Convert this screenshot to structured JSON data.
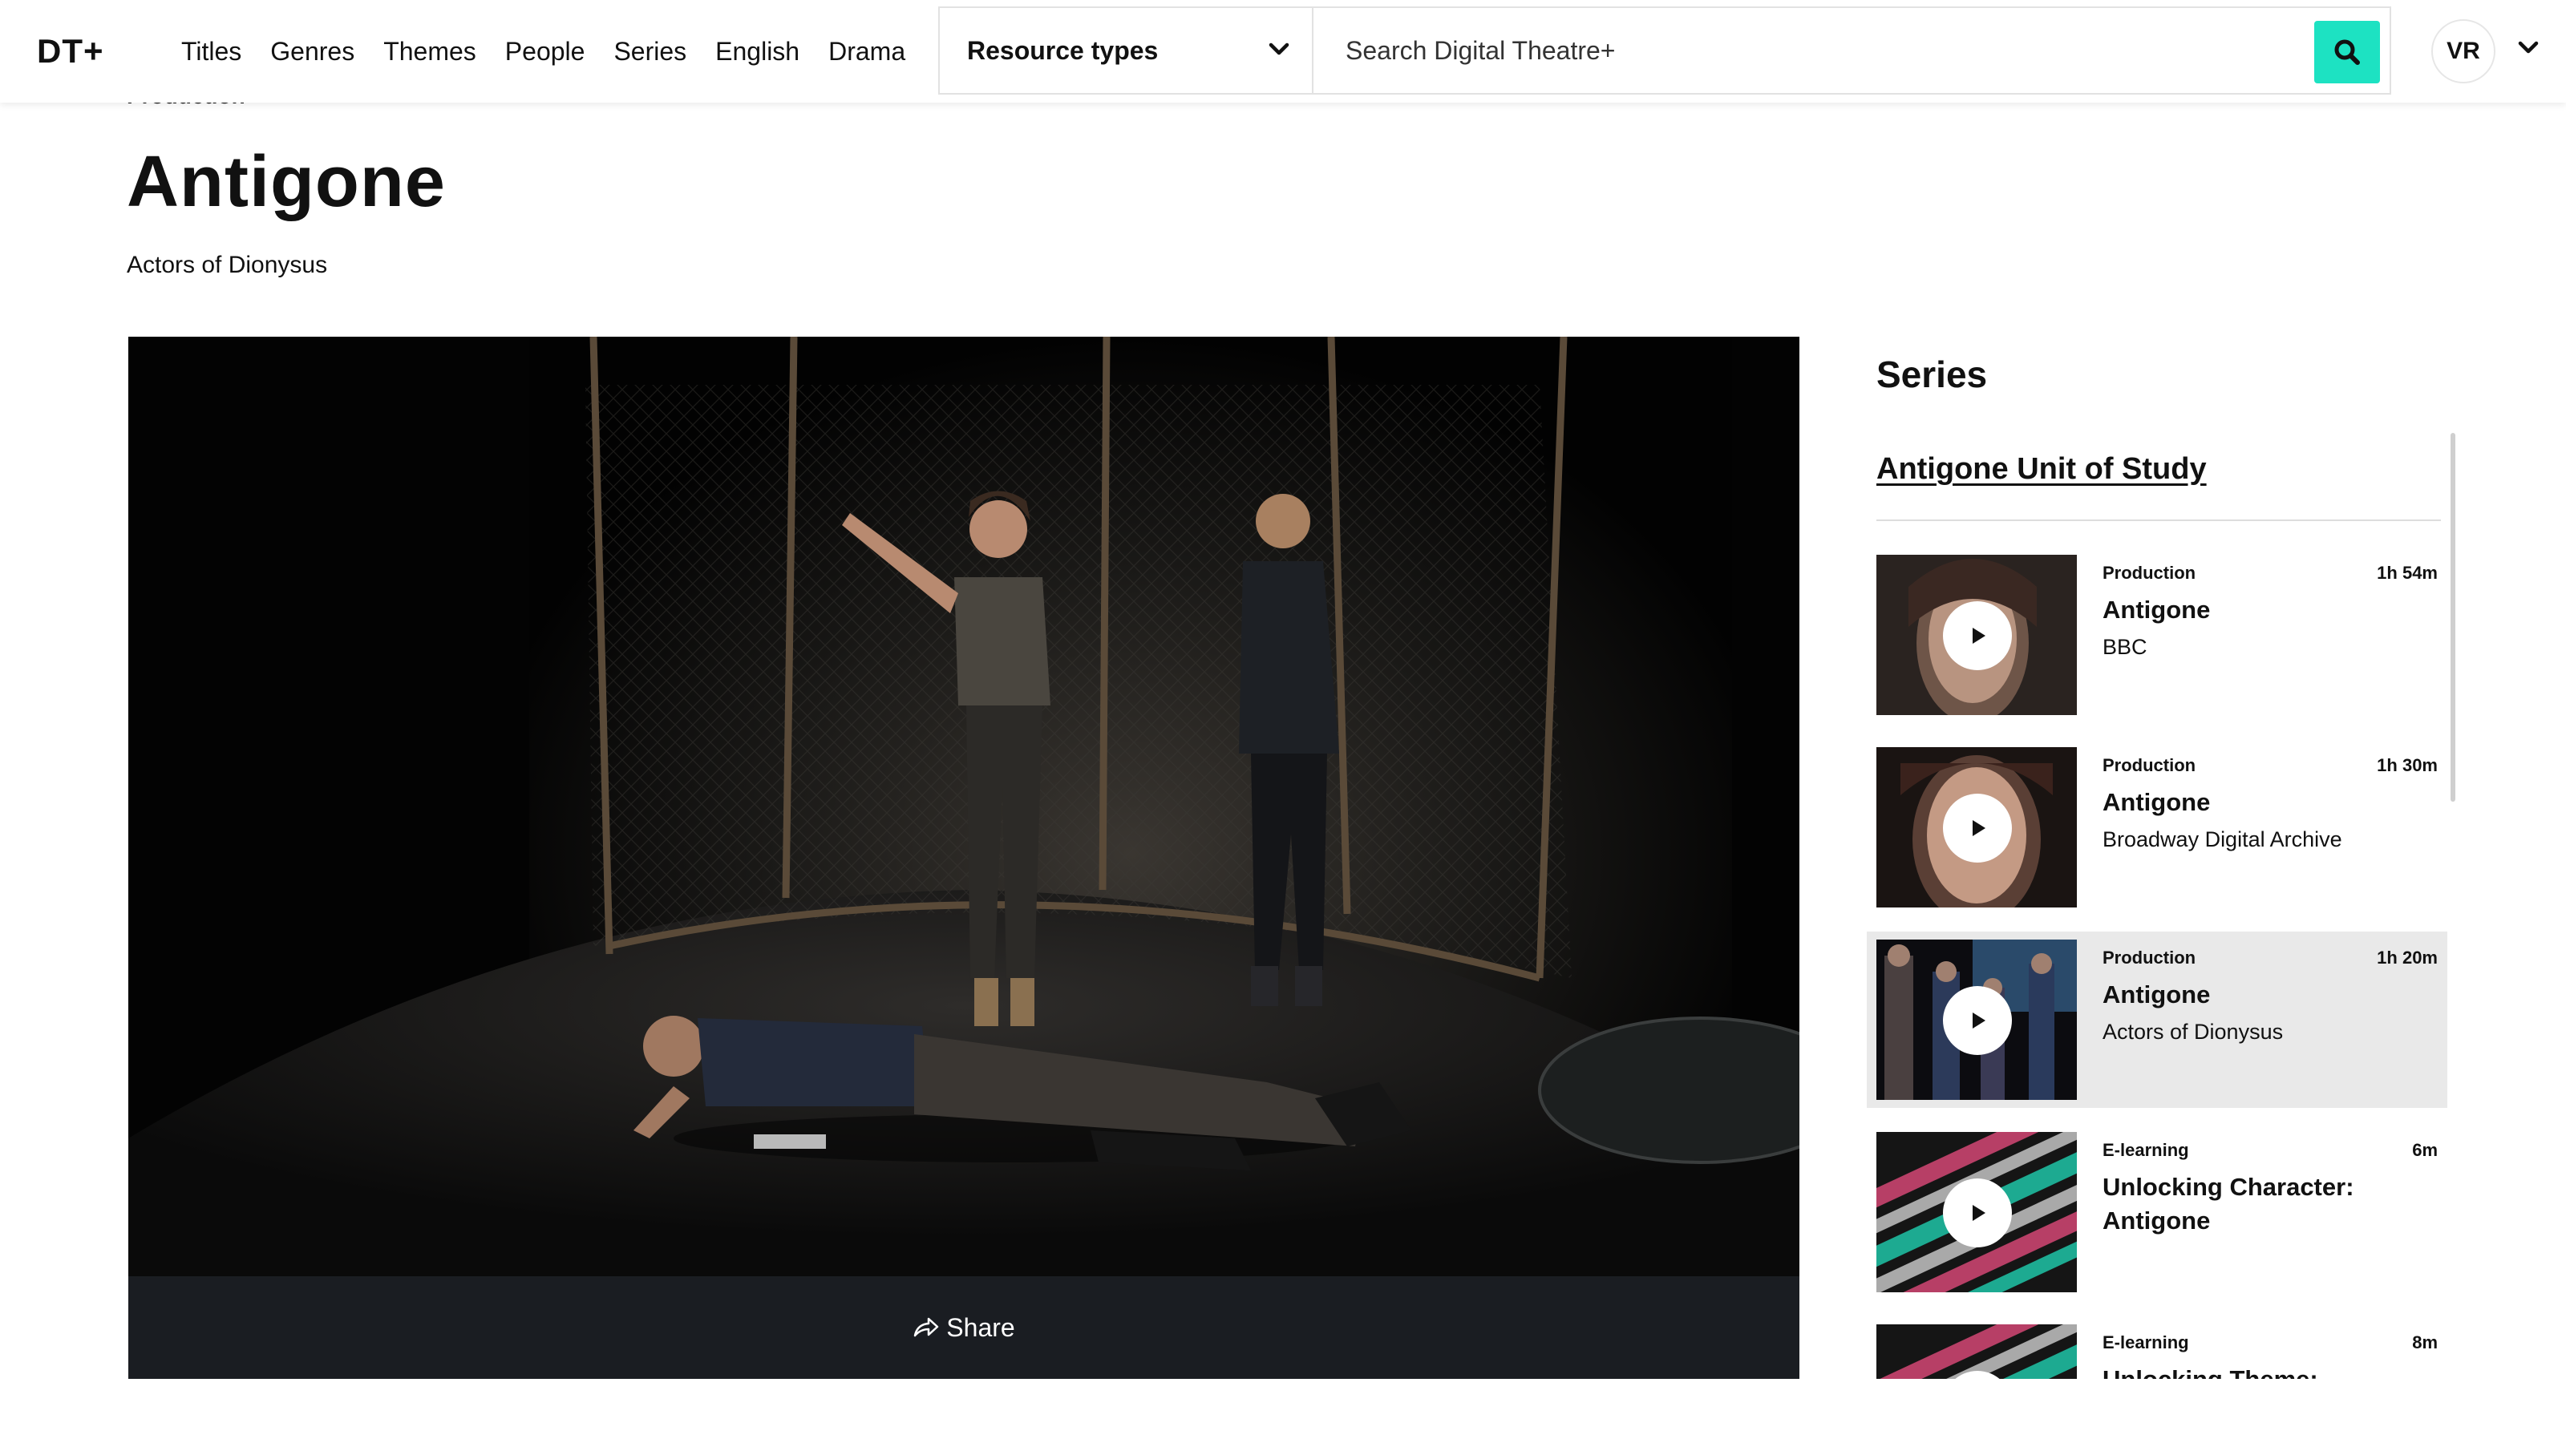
{
  "header": {
    "logo": "DT+",
    "nav": [
      "Titles",
      "Genres",
      "Themes",
      "People",
      "Series",
      "English",
      "Drama"
    ],
    "resource_types_label": "Resource types",
    "search_placeholder": "Search Digital Theatre+",
    "avatar_initials": "VR",
    "accent_color": "#1de2c2"
  },
  "page": {
    "overline": "Production",
    "title": "Antigone",
    "company": "Actors of Dionysus"
  },
  "player": {
    "share_label": "Share"
  },
  "series": {
    "heading": "Series",
    "unit_link": "Antigone Unit of Study",
    "items": [
      {
        "type": "Production",
        "duration": "1h 54m",
        "title": "Antigone",
        "subtitle": "BBC",
        "active": false
      },
      {
        "type": "Production",
        "duration": "1h 30m",
        "title": "Antigone",
        "subtitle": "Broadway Digital Archive",
        "active": false
      },
      {
        "type": "Production",
        "duration": "1h 20m",
        "title": "Antigone",
        "subtitle": "Actors of Dionysus",
        "active": true
      },
      {
        "type": "E-learning",
        "duration": "6m",
        "title": "Unlocking Character: Antigone",
        "subtitle": "",
        "active": false
      },
      {
        "type": "E-learning",
        "duration": "8m",
        "title": "Unlocking Theme: Morality",
        "subtitle": "",
        "active": false
      }
    ]
  }
}
